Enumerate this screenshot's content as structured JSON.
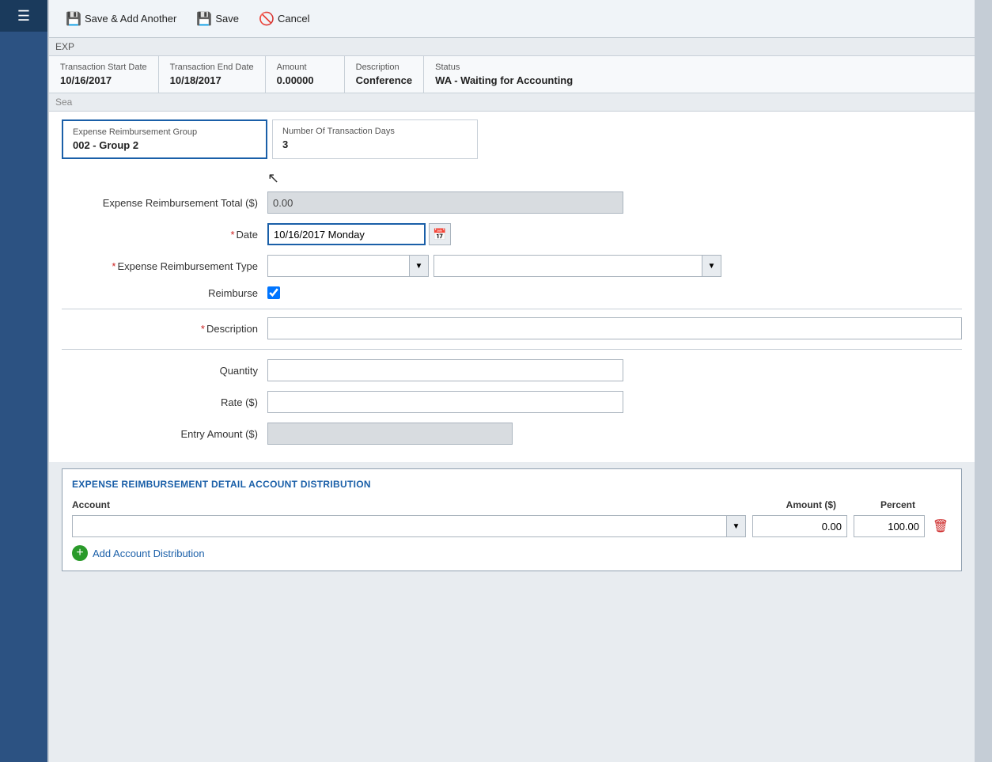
{
  "app": {
    "title": "Expense Reimbursement"
  },
  "toolbar": {
    "save_add_label": "Save & Add Another",
    "save_label": "Save",
    "cancel_label": "Cancel"
  },
  "transaction_info": {
    "start_date_label": "Transaction Start Date",
    "start_date_value": "10/16/2017",
    "end_date_label": "Transaction End Date",
    "end_date_value": "10/18/2017",
    "amount_label": "Amount",
    "amount_value": "0.00000",
    "description_label": "Description",
    "description_value": "Conference",
    "status_label": "Status",
    "status_value": "WA - Waiting for Accounting"
  },
  "group_section": {
    "group_label": "Expense Reimbursement Group",
    "group_value": "002 - Group 2",
    "days_label": "Number Of Transaction Days",
    "days_value": "3"
  },
  "form": {
    "total_label": "Expense Reimbursement Total ($)",
    "total_value": "0.00",
    "date_label": "Date",
    "date_value": "10/16/2017 Monday",
    "type_label": "Expense Reimbursement Type",
    "reimburse_label": "Reimburse",
    "description_label": "Description",
    "quantity_label": "Quantity",
    "rate_label": "Rate ($)",
    "entry_amount_label": "Entry Amount ($)"
  },
  "account_distribution": {
    "title": "EXPENSE REIMBURSEMENT DETAIL ACCOUNT DISTRIBUTION",
    "account_col": "Account",
    "amount_col": "Amount ($)",
    "percent_col": "Percent",
    "amount_value": "0.00",
    "percent_value": "100.00",
    "add_label": "Add Account Distribution"
  },
  "nav": {
    "expand_icon": "⊞"
  }
}
